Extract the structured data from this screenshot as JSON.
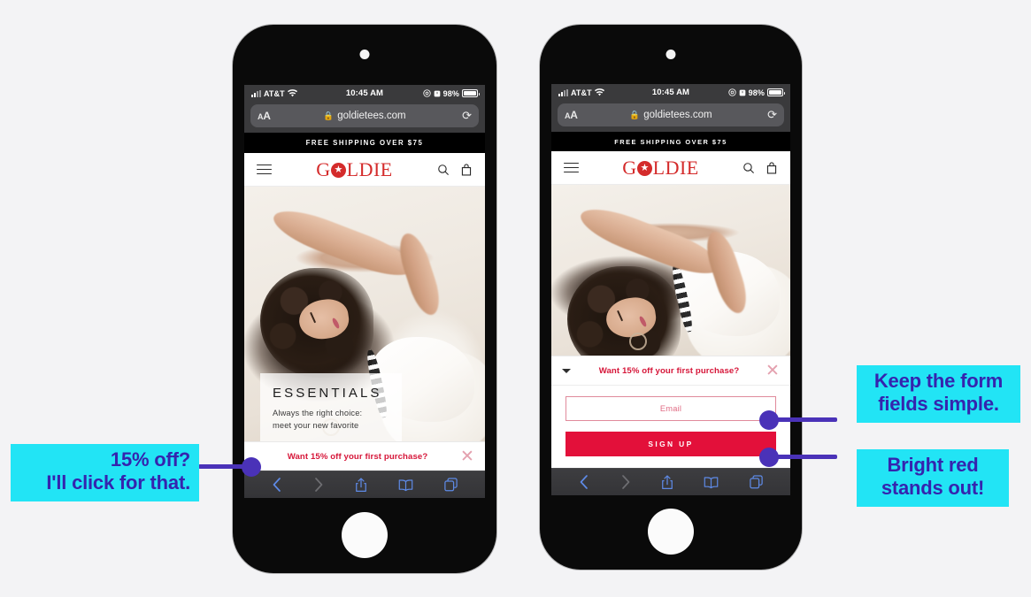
{
  "page": {
    "background_color": "#f3f3f5",
    "accent_cyan": "#22e4f5",
    "accent_purple": "#3524ae",
    "brand_red": "#d42b2b",
    "promo_red": "#d61639",
    "button_red": "#e3103a"
  },
  "status_bar": {
    "carrier": "AT&T",
    "time": "10:45 AM",
    "battery": "98%",
    "signal_icon": "cellular-signal-icon",
    "wifi_icon": "wifi-icon",
    "orientation_lock_icon": "orientation-lock-icon",
    "alarm_icon": "alarm-icon",
    "battery_icon": "battery-icon"
  },
  "url_bar": {
    "text_size_label": "AA",
    "url": "goldietees.com",
    "lock_icon": "lock-icon",
    "reload_icon": "reload-icon"
  },
  "site": {
    "announcement": "FREE SHIPPING OVER $75",
    "brand_part1": "G",
    "brand_star": "★",
    "brand_part2": "LDIE",
    "brand_full": "GOLDIE",
    "menu_icon": "hamburger-menu-icon",
    "search_icon": "search-icon",
    "bag_icon": "shopping-bag-icon"
  },
  "hero": {
    "headline": "ESSENTIALS",
    "subline_1": "Always the right choice:",
    "subline_2": "meet your new favorite",
    "alt": "woman-with-curly-hair-lying-down-in-white-tee"
  },
  "promo": {
    "message": "Want 15% off your first purchase?",
    "close_icon": "close-x-icon",
    "caret_icon": "caret-down-icon"
  },
  "signup": {
    "email_placeholder": "Email",
    "email_value": "",
    "button_label": "SIGN UP"
  },
  "safari_toolbar": {
    "back_icon": "back-chevron-icon",
    "forward_icon": "forward-chevron-icon",
    "share_icon": "share-icon",
    "bookmarks_icon": "bookmarks-book-icon",
    "tabs_icon": "tabs-icon"
  },
  "callouts": [
    {
      "line_1": "15% off?",
      "line_2": "I'll click for that."
    },
    {
      "line_1": "Keep the form",
      "line_2": "fields simple."
    },
    {
      "line_1": "Bright red",
      "line_2": "stands out!"
    }
  ]
}
